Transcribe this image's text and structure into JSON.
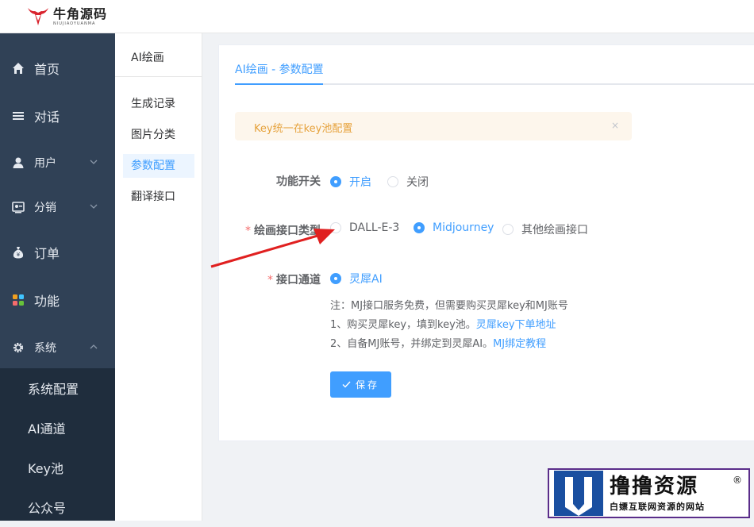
{
  "brand": {
    "name": "牛角源码",
    "tagline": "NIUJIAOYUANMA"
  },
  "sidebar": {
    "items": [
      {
        "label": "首页",
        "icon": "home-icon"
      },
      {
        "label": "对话",
        "icon": "list-icon"
      },
      {
        "label": "用户",
        "icon": "user-icon"
      },
      {
        "label": "分销",
        "icon": "distribution-icon"
      },
      {
        "label": "订单",
        "icon": "money-bag-icon"
      },
      {
        "label": "功能",
        "icon": "grid-icon"
      },
      {
        "label": "系统",
        "icon": "gear-icon"
      }
    ],
    "system_children": [
      "系统配置",
      "AI通道",
      "Key池",
      "公众号"
    ]
  },
  "subnav": {
    "title": "AI绘画",
    "items": [
      "生成记录",
      "图片分类",
      "参数配置",
      "翻译接口"
    ],
    "active_index": 2
  },
  "main": {
    "tab": "AI绘画 - 参数配置",
    "alert": "Key统一在key池配置",
    "alert_close": "×",
    "form": {
      "switch": {
        "label": "功能开关",
        "options": [
          "开启",
          "关闭"
        ],
        "selected": "开启"
      },
      "api_type": {
        "label": "绘画接口类型",
        "required": "*",
        "options": [
          "DALL-E-3",
          "Midjourney",
          "其他绘画接口"
        ],
        "selected": "Midjourney"
      },
      "channel": {
        "label": "接口通道",
        "required": "*",
        "options": [
          "灵犀AI"
        ],
        "selected": "灵犀AI"
      }
    },
    "notes": {
      "line1": "注：MJ接口服务免费，但需要购买灵犀key和MJ账号",
      "line2_text": "1、购买灵犀key，填到key池。",
      "line2_link": "灵犀key下单地址",
      "line3_text": "2、自备MJ账号，并绑定到灵犀AI。",
      "line3_link": "MJ绑定教程"
    },
    "save_label": "保存"
  },
  "watermark": {
    "title": "撸撸资源",
    "subtitle": "白嫖互联网资源的网站",
    "reg": "®"
  },
  "colors": {
    "primary": "#409eff",
    "sidebar_bg": "#304156",
    "submenu_bg": "#1f2d3d",
    "warning": "#e6a23c",
    "annotation_arrow": "#e02020"
  }
}
